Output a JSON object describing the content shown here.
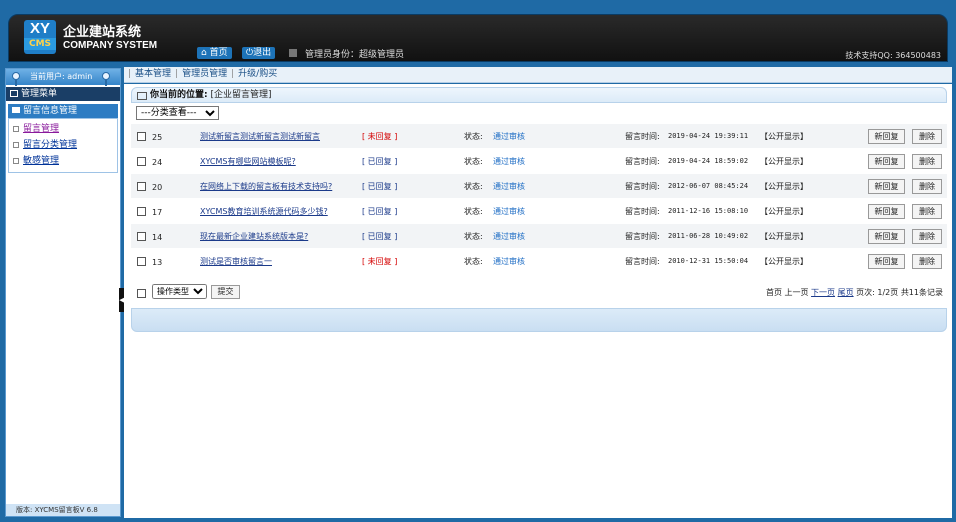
{
  "header": {
    "logo_top": "XY",
    "logo_bottom": "CMS",
    "brand_cn": "企业建站系统",
    "brand_en": "COMPANY SYSTEM",
    "home_label": "首页",
    "logout_label": "退出",
    "admin_role": "管理员身份：超级管理员",
    "support": "技术支持QQ: 364500483"
  },
  "sidebar": {
    "current_user": "当前用户: admin",
    "menu_title": "管理菜单",
    "group_title": "留言信息管理",
    "items": [
      {
        "label": "留言管理"
      },
      {
        "label": "留言分类管理"
      },
      {
        "label": "敏感管理"
      }
    ],
    "version": "版本: XYCMS留言板V 6.8"
  },
  "topnav": {
    "tabs": [
      "基本管理",
      "管理员管理",
      "升级/购买"
    ]
  },
  "main": {
    "breadcrumb_label": "你当前的位置:",
    "breadcrumb_value": "[企业留言管理]",
    "filter_selected": "---分类查看---",
    "status_label": "状态:",
    "time_label": "留言时间:",
    "reply_button": "新回复",
    "delete_button": "删除",
    "rows": [
      {
        "id": "25",
        "title": "测试新留言测试新留言测试新留言",
        "reply": "[ 未回复 ]",
        "replied": false,
        "status": "通过审核",
        "time": "2019-04-24 19:39:11",
        "visibility": "【公开显示】"
      },
      {
        "id": "24",
        "title": "XYCMS有哪些网站模板呢?",
        "reply": "[ 已回复 ]",
        "replied": true,
        "status": "通过审核",
        "time": "2019-04-24 18:59:02",
        "visibility": "【公开显示】"
      },
      {
        "id": "20",
        "title": "在网络上下载的留言板有技术支持吗?",
        "reply": "[ 已回复 ]",
        "replied": true,
        "status": "通过审核",
        "time": "2012-06-07 08:45:24",
        "visibility": "【公开显示】"
      },
      {
        "id": "17",
        "title": "XYCMS教育培训系统源代码多少钱?",
        "reply": "[ 已回复 ]",
        "replied": true,
        "status": "通过审核",
        "time": "2011-12-16 15:08:10",
        "visibility": "【公开显示】"
      },
      {
        "id": "14",
        "title": "现在最新企业建站系统版本是?",
        "reply": "[ 已回复 ]",
        "replied": true,
        "status": "通过审核",
        "time": "2011-06-28 10:49:02",
        "visibility": "【公开显示】"
      },
      {
        "id": "13",
        "title": "测试是否审核留言一",
        "reply": "[ 未回复 ]",
        "replied": false,
        "status": "通过审核",
        "time": "2010-12-31 15:50:04",
        "visibility": "【公开显示】"
      }
    ],
    "operation_select": "操作类型",
    "submit_label": "提交",
    "pager": {
      "first": "首页",
      "prev": "上一页",
      "next": "下一页",
      "last": "尾页",
      "page_info": "页次: 1/2页",
      "total": "共11条记录"
    }
  },
  "colors": {
    "frame_blue": "#1f6aa5",
    "unreplied_red": "#d40000",
    "link_blue": "#1b3a8a"
  }
}
